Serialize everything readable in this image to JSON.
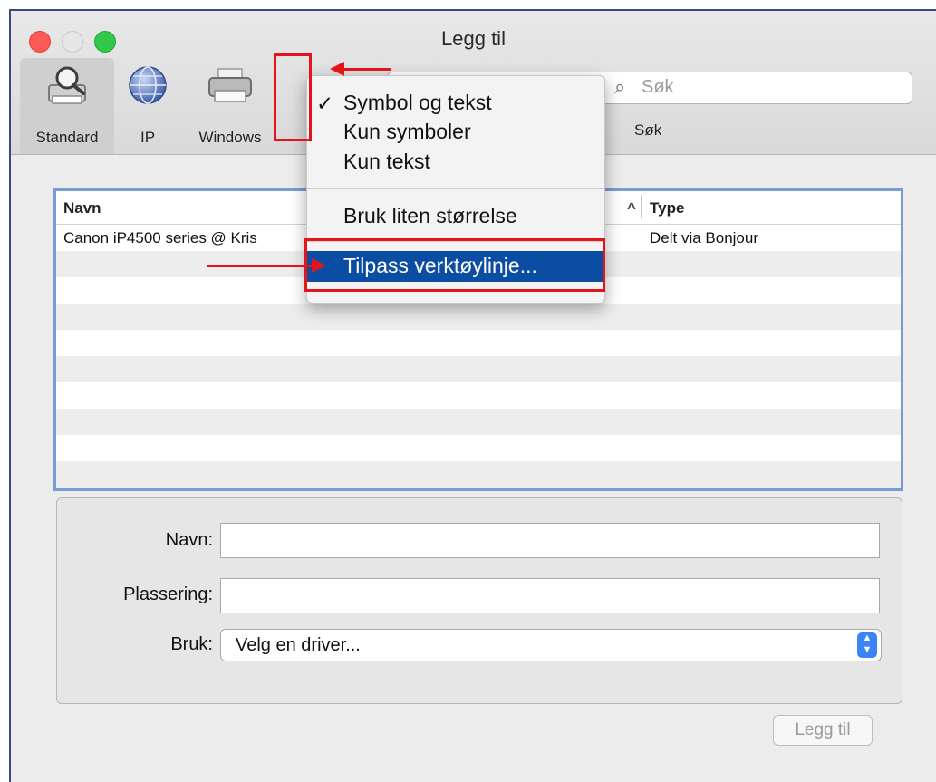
{
  "window": {
    "title": "Legg til"
  },
  "toolbar": {
    "items": [
      {
        "label": "Standard",
        "icon": "magnifier-printer-icon"
      },
      {
        "label": "IP",
        "icon": "globe-icon"
      },
      {
        "label": "Windows",
        "icon": "printer-icon"
      }
    ],
    "search": {
      "placeholder": "Søk",
      "label": "Søk"
    }
  },
  "context_menu": {
    "items": [
      {
        "label": "Symbol og tekst",
        "checked": true
      },
      {
        "label": "Kun symboler"
      },
      {
        "label": "Kun tekst"
      },
      {
        "label": "Bruk liten størrelse"
      },
      {
        "label": "Tilpass verktøylinje...",
        "highlighted": true
      }
    ]
  },
  "printer_list": {
    "columns": [
      "Navn",
      "Type"
    ],
    "sort_indicator": "^",
    "rows": [
      {
        "name": "Canon iP4500 series @ Kris",
        "type": "Delt via Bonjour"
      }
    ]
  },
  "form": {
    "name_label": "Navn:",
    "location_label": "Plassering:",
    "use_label": "Bruk:",
    "driver_value": "Velg en driver..."
  },
  "add_button": "Legg til",
  "colors": {
    "annotation_red": "#e3151a",
    "menu_highlight": "#0b4da2",
    "stepper_blue": "#3a84f5"
  }
}
